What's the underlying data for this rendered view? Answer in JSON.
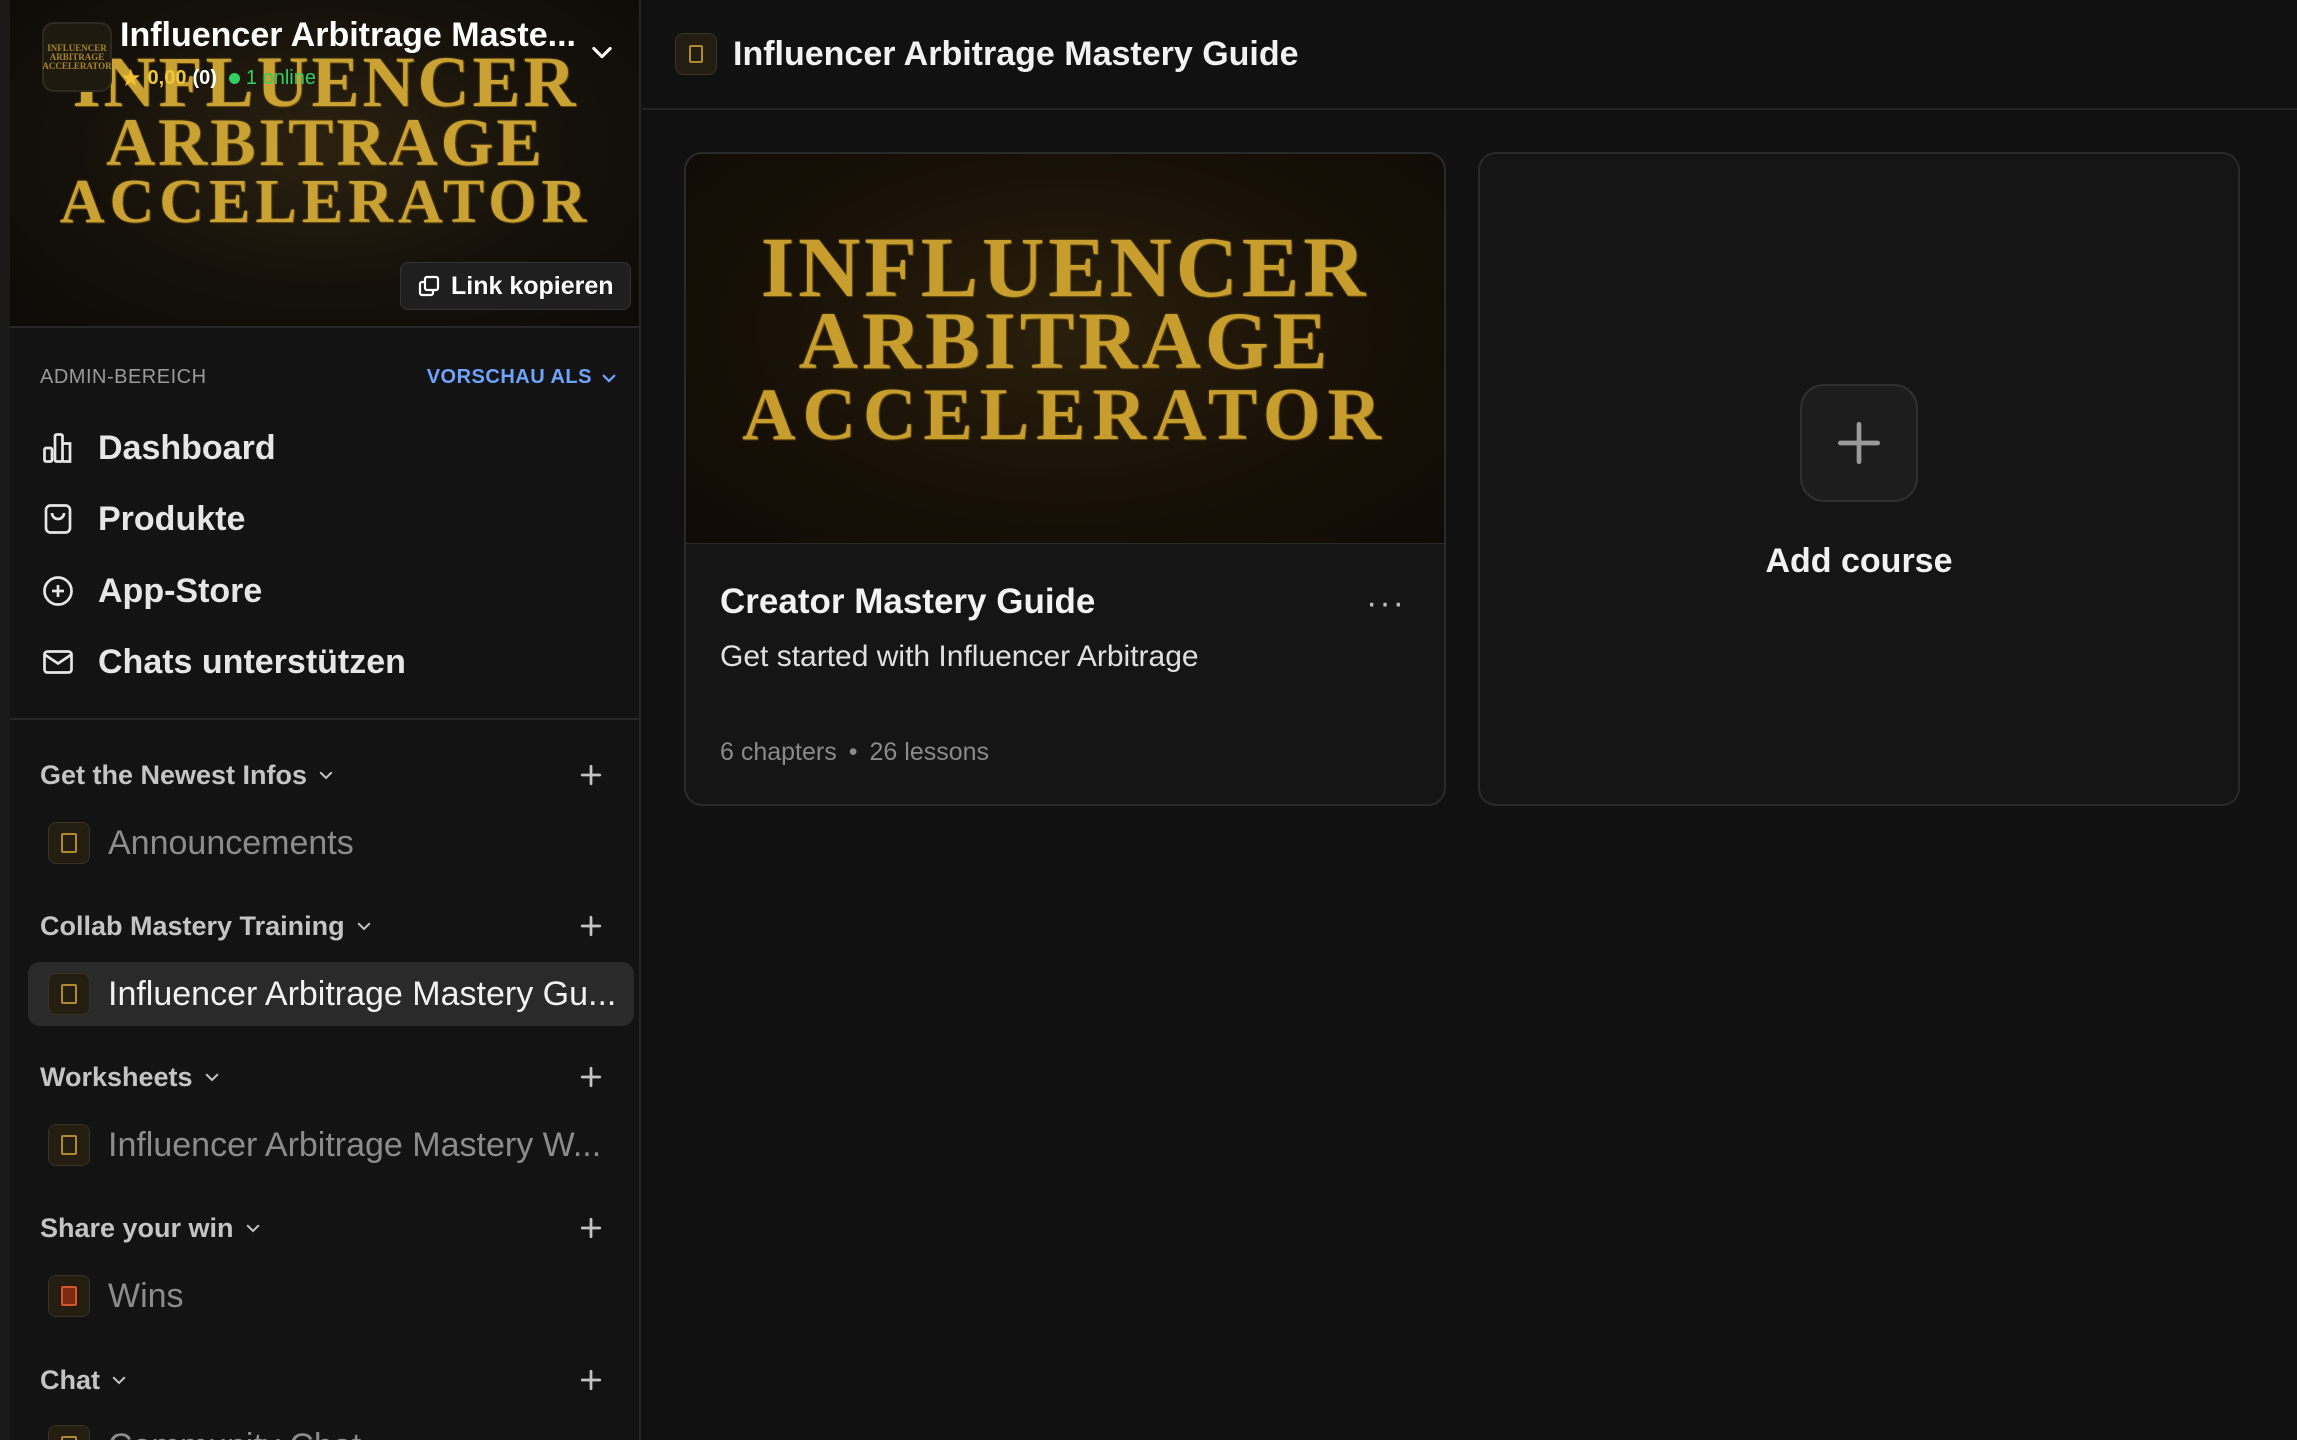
{
  "workspace": {
    "name": "Influencer Arbitrage Maste...",
    "rating": "0,00",
    "review_count": "(0)",
    "online": "1 online",
    "logo_text": "INFLUENCER ARBITRAGE ACCELERATOR",
    "banner_lines": [
      "INFLUENCER",
      "ARBITRAGE",
      "ACCELERATOR"
    ],
    "copy_link_label": "Link kopieren"
  },
  "admin": {
    "label": "ADMIN-BEREICH",
    "preview_label": "VORSCHAU ALS"
  },
  "nav": {
    "dashboard": "Dashboard",
    "products": "Produkte",
    "app_store": "App-Store",
    "support_chats": "Chats unterstützen"
  },
  "sections": [
    {
      "title": "Get the Newest Infos",
      "channels": [
        {
          "label": "Announcements"
        }
      ]
    },
    {
      "title": "Collab Mastery Training",
      "channels": [
        {
          "label": "Influencer Arbitrage Mastery Gu..."
        }
      ]
    },
    {
      "title": "Worksheets",
      "channels": [
        {
          "label": "Influencer Arbitrage Mastery W..."
        }
      ]
    },
    {
      "title": "Share your win",
      "channels": [
        {
          "label": "Wins"
        }
      ]
    },
    {
      "title": "Chat",
      "channels": [
        {
          "label": "Community Chat"
        }
      ]
    }
  ],
  "main": {
    "page_title": "Influencer Arbitrage Mastery Guide",
    "course": {
      "cover_lines": [
        "INFLUENCER",
        "ARBITRAGE",
        "ACCELERATOR"
      ],
      "title": "Creator Mastery Guide",
      "description": "Get started with Influencer Arbitrage",
      "chapters": "6 chapters",
      "separator": "•",
      "lessons": "26 lessons",
      "menu": "···"
    },
    "add_course_label": "Add course"
  },
  "colors": {
    "accent_gold": "#c9a233",
    "link_blue": "#6ea4ff",
    "online_green": "#2fcf63",
    "star_yellow": "#f2c230",
    "background": "#111111"
  },
  "icons": [
    "chevron-down-icon",
    "star-icon",
    "copy-link-icon",
    "bar-chart-icon",
    "shopping-bag-icon",
    "plus-circle-icon",
    "mail-icon",
    "plus-icon",
    "course-icon",
    "ellipsis-icon"
  ]
}
